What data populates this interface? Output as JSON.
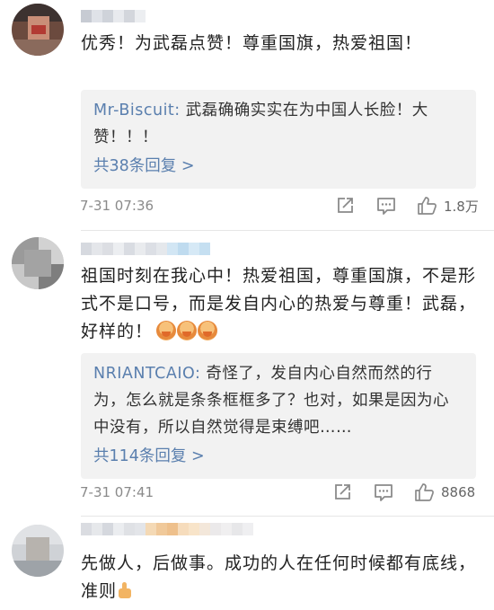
{
  "comments": [
    {
      "text": "优秀！为武磊点赞！尊重国旗，热爱祖国！",
      "reply": {
        "author": "Mr-Biscuit:",
        "text": " 武磊确确实实在为中国人长脸！大赞！！！",
        "count": "共38条回复 >"
      },
      "time": "7-31 07:36",
      "likes": "1.8万"
    },
    {
      "text": "祖国时刻在我心中！热爱祖国，尊重国旗，不是形式不是口号，而是发自内心的热爱与尊重！武磊，好样的！",
      "reply": {
        "author": "NRIANTCAIO:",
        "text": " 奇怪了，发自内心自然而然的行为，怎么就是条条框框多了？也对，如果是因为心中没有，所以自然觉得是束缚吧……",
        "count": "共114条回复 >"
      },
      "time": "7-31 07:41",
      "likes": "8868"
    },
    {
      "text": "先做人，后做事。成功的人在任何时候都有底线，准则"
    }
  ],
  "icons": {
    "share": "share-icon",
    "comment": "comment-icon",
    "like": "thumbs-up-icon"
  }
}
